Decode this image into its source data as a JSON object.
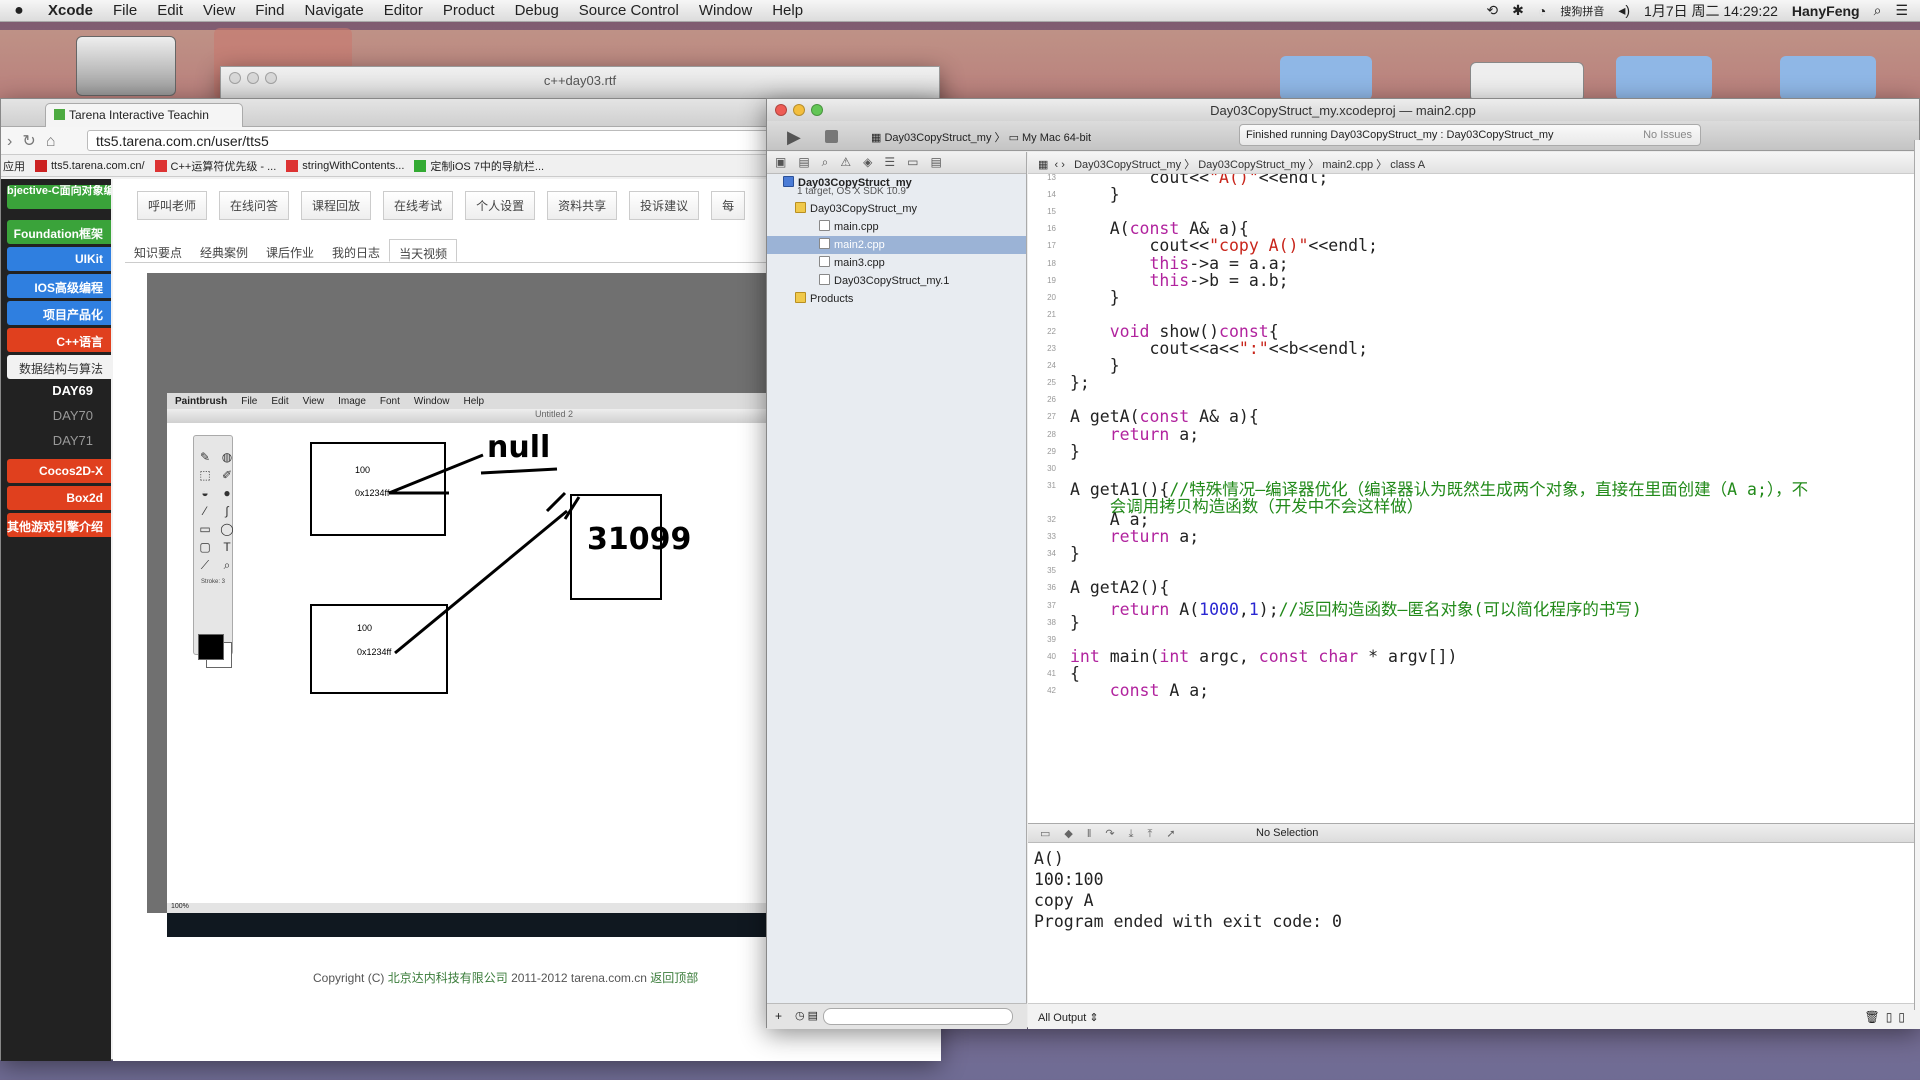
{
  "menubar": {
    "app": "Xcode",
    "items": [
      "File",
      "Edit",
      "View",
      "Find",
      "Navigate",
      "Editor",
      "Product",
      "Debug",
      "Source Control",
      "Window",
      "Help"
    ],
    "ime": "搜狗拼音",
    "datetime": "1月7日 周二 14:29:22",
    "user": "HanyFeng"
  },
  "rtf_window": {
    "title": "c++day03.rtf"
  },
  "browser": {
    "tab_title": "Tarena Interactive Teachin",
    "url": "tts5.tarena.com.cn/user/tts5",
    "bookmarks": [
      "应用",
      "tts5.tarena.com.cn/",
      "C++运算符优先级 - ...",
      "stringWithContents...",
      "定制iOS 7中的导航栏..."
    ],
    "sidebar": [
      {
        "label": "bjective-C面向对象编程",
        "color": "#3aa33a"
      },
      {
        "label": "Foundation框架",
        "color": "#3aa33a"
      },
      {
        "label": "UIKit",
        "color": "#2f7fe0"
      },
      {
        "label": "IOS高级编程",
        "color": "#2f7fe0"
      },
      {
        "label": "项目产品化",
        "color": "#2f7fe0"
      },
      {
        "label": "C++语言",
        "color": "#e0401e"
      },
      {
        "label": "数据结构与算法",
        "color": "#f2f2f2"
      }
    ],
    "days": [
      "DAY69",
      "DAY70",
      "DAY71"
    ],
    "sidebar2": [
      {
        "label": "Cocos2D-X",
        "color": "#e0401e"
      },
      {
        "label": "Box2d",
        "color": "#e0401e"
      },
      {
        "label": "其他游戏引擎介绍",
        "color": "#e0401e"
      }
    ],
    "topnav": [
      "呼叫老师",
      "在线问答",
      "课程回放",
      "在线考试",
      "个人设置",
      "资料共享",
      "投诉建议",
      "每"
    ],
    "subnav": [
      "知识要点",
      "经典案例",
      "课后作业",
      "我的日志",
      "当天视频"
    ],
    "footer": {
      "copyright": "Copyright (C)",
      "company": "北京达内科技有限公司",
      "years": "2011-2012 tarena.com.cn",
      "top": "返回顶部"
    }
  },
  "paintbrush": {
    "menu": [
      "Paintbrush",
      "File",
      "Edit",
      "View",
      "Image",
      "Font",
      "Window",
      "Help"
    ],
    "title": "Untitled 2",
    "stroke_label": "Stroke: 3",
    "zoom": "100%",
    "drawing": {
      "box1_val": "100",
      "box1_addr": "0x1234ff",
      "box2_val": "100",
      "box2_addr": "0x1234ff",
      "note_null": "null",
      "note_num": "31099"
    }
  },
  "xcode": {
    "title_proj": "Day03CopyStruct_my.xcodeproj",
    "title_sep": "—",
    "title_file": "main2.cpp",
    "scheme": "Day03CopyStruct_my",
    "destination": "My Mac 64-bit",
    "status": "Finished running Day03CopyStruct_my : Day03CopyStruct_my",
    "issues": "No Issues",
    "tree": [
      {
        "label": "Day03CopyStruct_my",
        "sub": "1 target, OS X SDK 10.9",
        "kind": "proj",
        "indent": 16
      },
      {
        "label": "Day03CopyStruct_my",
        "kind": "folder",
        "indent": 28
      },
      {
        "label": "main.cpp",
        "kind": "file",
        "indent": 52
      },
      {
        "label": "main2.cpp",
        "kind": "file",
        "indent": 52,
        "selected": true
      },
      {
        "label": "main3.cpp",
        "kind": "file",
        "indent": 52
      },
      {
        "label": "Day03CopyStruct_my.1",
        "kind": "file",
        "indent": 52
      },
      {
        "label": "Products",
        "kind": "folder",
        "indent": 28
      }
    ],
    "jumpbar": [
      "Day03CopyStruct_my",
      "Day03CopyStruct_my",
      "main2.cpp",
      "class A"
    ],
    "code": [
      {
        "n": "13",
        "html": "        cout&lt;&lt;<span class=\"str\">\"A()\"</span>&lt;&lt;endl;"
      },
      {
        "n": "14",
        "html": "    }"
      },
      {
        "n": "15",
        "html": ""
      },
      {
        "n": "16",
        "html": "    A(<span class=\"kw\">const</span> A&amp; a){"
      },
      {
        "n": "17",
        "html": "        cout&lt;&lt;<span class=\"str\">\"copy A()\"</span>&lt;&lt;endl;"
      },
      {
        "n": "18",
        "html": "        <span class=\"kw\">this</span>-&gt;a = a.a;"
      },
      {
        "n": "19",
        "html": "        <span class=\"kw\">this</span>-&gt;b = a.b;"
      },
      {
        "n": "20",
        "html": "    }"
      },
      {
        "n": "21",
        "html": ""
      },
      {
        "n": "22",
        "html": "    <span class=\"kw\">void</span> show()<span class=\"kw\">const</span>{"
      },
      {
        "n": "23",
        "html": "        cout&lt;&lt;a&lt;&lt;<span class=\"str\">\":\"</span>&lt;&lt;b&lt;&lt;endl;"
      },
      {
        "n": "24",
        "html": "    }"
      },
      {
        "n": "25",
        "html": "};"
      },
      {
        "n": "26",
        "html": ""
      },
      {
        "n": "27",
        "html": "A getA(<span class=\"kw\">const</span> A&amp; a){"
      },
      {
        "n": "28",
        "html": "    <span class=\"kw\">return</span> a;"
      },
      {
        "n": "29",
        "html": "}"
      },
      {
        "n": "30",
        "html": ""
      },
      {
        "n": "31",
        "html": "A getA1(){<span class=\"cm\">//特殊情况—编译器优化（编译器认为既然生成两个对象，直接在里面创建（A a;），不</span>"
      },
      {
        "n": "",
        "html": "    <span class=\"cm\">会调用拷贝构造函数（开发中不会这样做）</span>"
      },
      {
        "n": "32",
        "html": "    A a;"
      },
      {
        "n": "33",
        "html": "    <span class=\"kw\">return</span> a;"
      },
      {
        "n": "34",
        "html": "}"
      },
      {
        "n": "35",
        "html": ""
      },
      {
        "n": "36",
        "html": "A getA2(){"
      },
      {
        "n": "37",
        "html": "    <span class=\"kw\">return</span> A(<span class=\"num\">1000</span>,<span class=\"num\">1</span>);<span class=\"cm\">//返回构造函数—匿名对象(可以简化程序的书写)</span>"
      },
      {
        "n": "38",
        "html": "}"
      },
      {
        "n": "39",
        "html": ""
      },
      {
        "n": "40",
        "html": "<span class=\"kw\">int</span> main(<span class=\"kw\">int</span> argc, <span class=\"kw\">const</span> <span class=\"kw\">char</span> * argv[])"
      },
      {
        "n": "41",
        "html": "{"
      },
      {
        "n": "42",
        "html": "    <span class=\"kw\">const</span> A a;"
      }
    ],
    "debug_selection": "No Selection",
    "console": [
      "A()",
      "100:100",
      "copy A",
      "Program ended with exit code: 0"
    ],
    "output_label": "All Output ⇕"
  }
}
